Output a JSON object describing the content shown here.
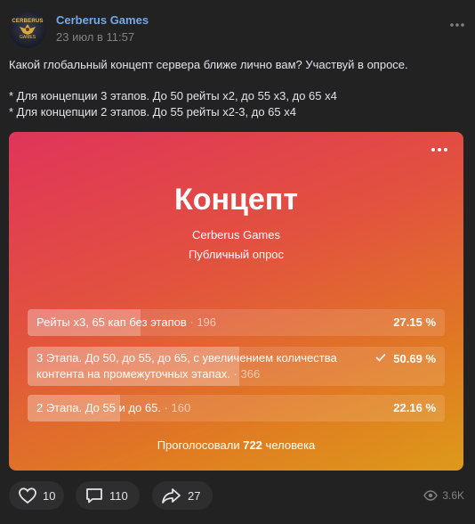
{
  "post": {
    "author": "Cerberus Games",
    "date": "23 июл в 11:57",
    "avatar_text": "CERBERUS",
    "avatar_subtext": "GAMES",
    "text": [
      "Какой глобальный концепт сервера ближе лично вам? Участвуй в опросе.",
      "* Для концепции 3 этапов. До 50 рейты х2, до 55 х3, до 65 х4",
      "* Для концепции 2 этапов. До 55 рейты х2-3, до 65 х4"
    ]
  },
  "poll": {
    "title": "Концепт",
    "author": "Cerberus Games",
    "type": "Публичный опрос",
    "options": [
      {
        "label": "Рейты х3, 65 кап без этапов",
        "count": "· 196",
        "percent": "27.15 %",
        "fill": 0.2715,
        "selected": false
      },
      {
        "label": "3 Этапа. До 50, до 55, до 65, с увеличением количества контента на промежуточных этапах.",
        "count": "· 366",
        "percent": "50.69 %",
        "fill": 0.5069,
        "selected": true
      },
      {
        "label": "2 Этапа. До 55 и до 65.",
        "count": "· 160",
        "percent": "22.16 %",
        "fill": 0.2216,
        "selected": false
      }
    ],
    "total_prefix": "Проголосовали",
    "total_count": "722",
    "total_suffix": "человека"
  },
  "actions": {
    "likes": "10",
    "comments": "110",
    "shares": "27",
    "views": "3.6K"
  },
  "colors": {
    "link": "#71aaeb",
    "background": "#222222",
    "gradient_start": "#e0345a",
    "gradient_end": "#dd9a1a"
  }
}
